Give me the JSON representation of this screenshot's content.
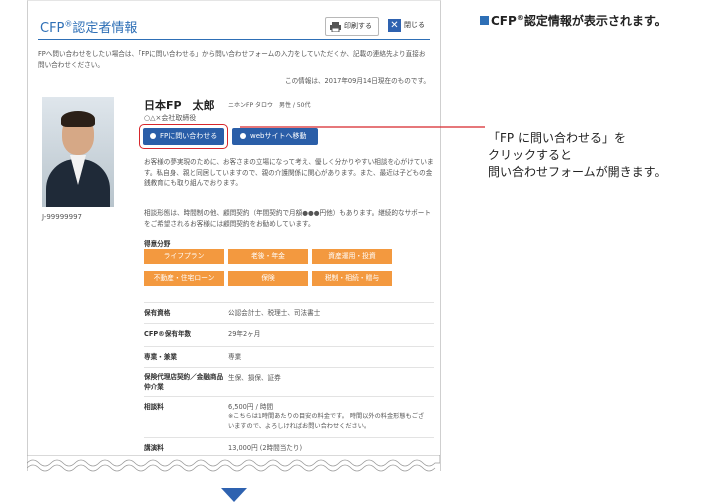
{
  "heading": {
    "prefix": "CFP",
    "sup": "®",
    "text": "認定情報が表示されます。"
  },
  "panel": {
    "title_prefix": "CFP",
    "title_sup": "®",
    "title_text": "認定者情報",
    "print_label": "印刷する",
    "close_label": "閉じる",
    "intro": "FPへ問い合わせをしたい場合は、「FPに問い合わせる」から問い合わせフォームの入力をしていただくか、記載の連絡先より直接お問い合わせください。",
    "as_of": "この情報は、2017年09月14日現在のものです。",
    "member_id": "J-99999997",
    "name": "日本FP　太郎",
    "name_sub": "ニホンFP タロウ　男性 / 50代",
    "company": "○△×会社取締役",
    "contact_label": "FPに問い合わせる",
    "web_label": "webサイトへ移動",
    "desc1": "お客様の夢実現のために、お客さまの立場になって考え、優しく分かりやすい相談を心がけています。私自身、親と同居していますので、親の介護関係に関心があります。また、最近は子どもの金銭教育にも取り組んでおります。",
    "desc2": "相談形態は、時間制の他、顧問契約（年間契約で月額●●●円他）もあります。継続的なサポートをご希望されるお客様には顧問契約をお勧めしています。",
    "fields_label": "得意分野",
    "tags": [
      "ライフプラン",
      "老後・年金",
      "資産運用・投資",
      "不動産・住宅ローン",
      "保険",
      "税制・相続・贈与"
    ],
    "rows": [
      {
        "key": "保有資格",
        "value": "公認会計士、税理士、司法書士"
      },
      {
        "key": "CFP®保有年数",
        "value": "29年2ヶ月"
      },
      {
        "key": "専業・兼業",
        "value": "専業"
      },
      {
        "key": "保険代理店契約／金融商品仲介業",
        "value": "生保、損保、証券"
      },
      {
        "key": "相談料",
        "value": "6,500円 / 時間",
        "note": "※こちらは1時間あたりの目安の料金です。 時間以外の料金形態もございますので、よろしければお問い合わせください。"
      },
      {
        "key": "講演料",
        "value": "13,000円 (2時間当たり)"
      }
    ]
  },
  "callout": {
    "line1": "「FP に問い合わせる」を",
    "line2": "クリックすると",
    "line3": "問い合わせフォームが開きます。"
  },
  "colors": {
    "accent": "#2e6fb6",
    "button": "#2a5ea8",
    "tag": "#f3993f",
    "highlight": "#d6262b"
  }
}
